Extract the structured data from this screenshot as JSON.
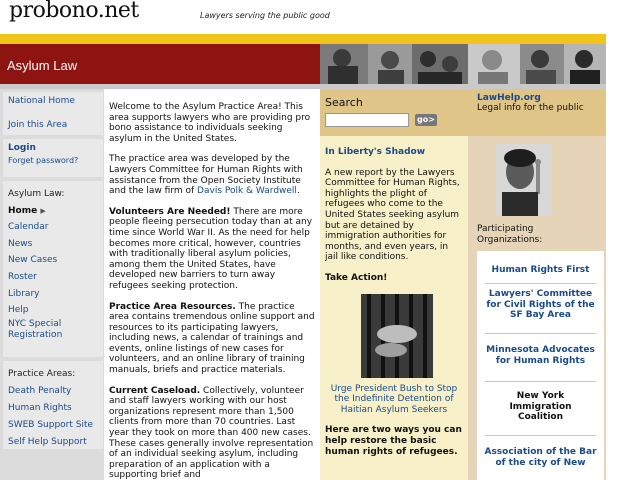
{
  "header": {
    "logo": "probono.net",
    "tagline": "Lawyers serving the public good"
  },
  "page_title": "Asylum Law",
  "left_nav": {
    "top_links": [
      "National Home",
      "Join this Area"
    ],
    "login": "Login",
    "forgot_password": "Forget password?",
    "asylum_heading": "Asylum Law:",
    "asylum_items": [
      "Home",
      "Calendar",
      "News",
      "New Cases",
      "Roster",
      "Library",
      "Help",
      "NYC Special Registration"
    ],
    "practice_heading": "Practice Areas:",
    "practice_items": [
      "Death Penalty",
      "Human Rights",
      "SWEB Support Site",
      "Self Help Support"
    ]
  },
  "main": {
    "intro": "Welcome to the Asylum Practice Area! This area supports lawyers who are providing pro bono assistance to individuals seeking asylum in the United States.",
    "developed_pre": "The practice area was developed by the Lawyers Committee for Human Rights with assistance from the Open Society Institute and the law firm of ",
    "developed_link": "Davis Polk & Wardwell",
    "developed_post": ".",
    "volunteers_head": "Volunteers Are Needed!",
    "volunteers_body": " There are more people fleeing persecution today than at any time since World War II. As the need for help becomes more critical, however, countries with traditionally liberal asylum policies, among them the United States, have developed new barriers to turn away refugees seeking protection.",
    "resources_head": "Practice Area Resources.",
    "resources_body": " The practice area contains tremendous online support and resources to its participating lawyers, including news, a calendar of trainings and events, online listings of new cases for volunteers, and an online library of training manuals, briefs and practice materials.",
    "caseload_head": "Current Caseload.",
    "caseload_body": " Collectively, volunteer and staff lawyers working with our host organizations represent more than 1,500 clients from more than 70 countries. Last year they took on more than 400 new cases. These cases generally involve representation of an individual seeking asylum, including preparation of an application with a supporting brief and"
  },
  "search": {
    "title": "Search",
    "placeholder": "",
    "go_label": "go>"
  },
  "feature": {
    "title": "In Liberty's Shadow",
    "body": "A new report by the Lawyers Committee for Human Rights, highlights the plight of refugees who come to the United States seeking asylum but are detained by immigration authorities for months, and even years, in jail like conditions.",
    "action": "Take Action!",
    "link": "Urge President Bush to Stop the Indefinite Detention of Haitian Asylum Seekers",
    "closing": "Here are two ways you can help restore the basic human rights of refugees."
  },
  "right": {
    "lawhelp_title": "LawHelp.org",
    "lawhelp_sub": "Legal info for the public",
    "participating": "Participating Organizations:",
    "orgs": [
      "Human Rights First",
      "Lawyers' Committee for Civil Rights of the SF Bay Area",
      "Minnesota Advocates for Human Rights",
      "New York Immigration Coalition",
      "Association of the Bar of the city of New"
    ]
  }
}
